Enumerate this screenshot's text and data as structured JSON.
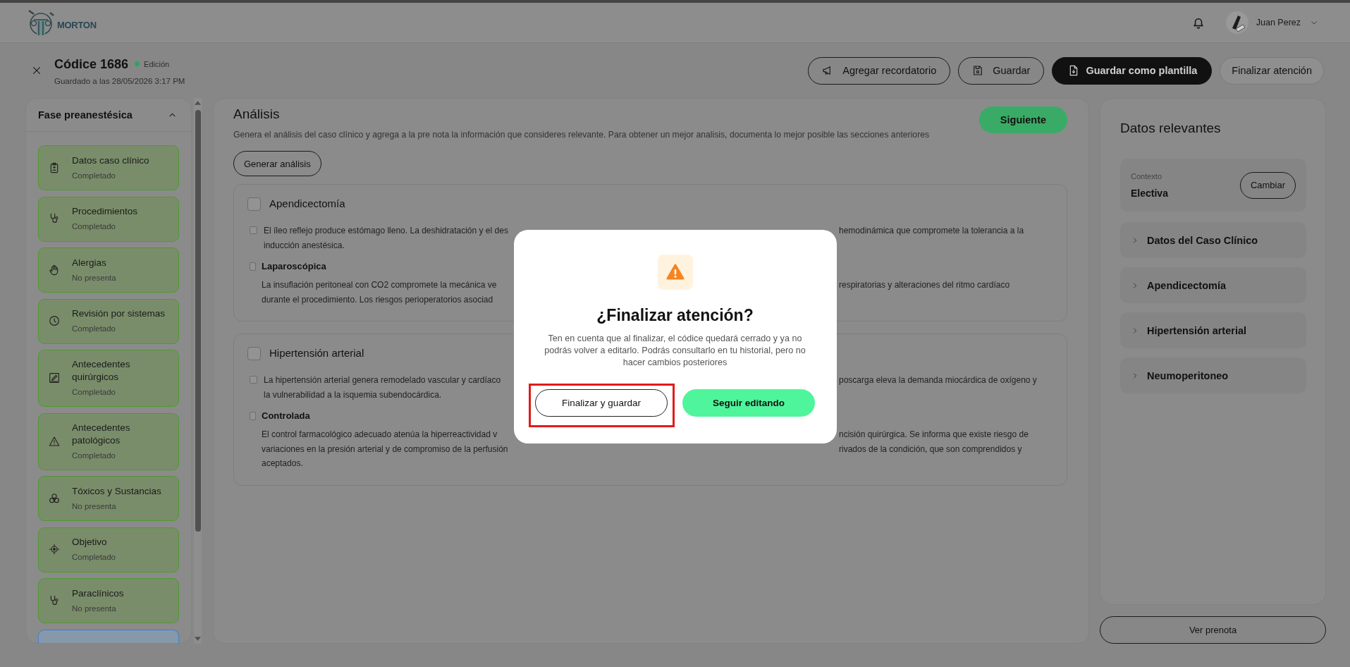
{
  "header": {
    "logo_text": "MORTON",
    "user_name": "Juan Perez"
  },
  "record": {
    "title": "Códice 1686",
    "status": "Edición",
    "saved_at": "Guardado a las 28/05/2026 3:17 PM"
  },
  "actions": [
    {
      "label": "Agregar recordatorio",
      "kind": "reminder"
    },
    {
      "label": "Guardar",
      "kind": "save"
    },
    {
      "label": "Guardar como plantilla",
      "kind": "template"
    },
    {
      "label": "Finalizar atención",
      "kind": "finish"
    }
  ],
  "sidebar": {
    "title": "Fase preanestésica",
    "expanded": true,
    "items": [
      {
        "label": "Datos caso clínico",
        "status": "Completado",
        "selected": false
      },
      {
        "label": "Procedimientos",
        "status": "Completado",
        "selected": false
      },
      {
        "label": "Alergias",
        "status": "No presenta",
        "selected": false
      },
      {
        "label": "Revisión por sistemas",
        "status": "Completado",
        "selected": false
      },
      {
        "label": "Antecedentes quirúrgicos",
        "status": "Completado",
        "selected": false
      },
      {
        "label": "Antecedentes patológicos",
        "status": "Completado",
        "selected": false
      },
      {
        "label": "Tóxicos y Sustancias",
        "status": "No presenta",
        "selected": false
      },
      {
        "label": "Objetivo",
        "status": "Completado",
        "selected": false
      },
      {
        "label": "Paraclínicos",
        "status": "No presenta",
        "selected": false
      },
      {
        "selected": true
      }
    ]
  },
  "analysis": {
    "title": "Análisis",
    "description": "Genera el análisis del caso clínico y agrega a la pre nota la información que consideres relevante. Para obtener un mejor analisis, documenta lo mejor posible las secciones anteriores",
    "next_button": "Siguiente",
    "generate_button": "Generar análisis",
    "cards": [
      {
        "title": "Apendicectomía",
        "checked": false,
        "entries": [
          {
            "kind": "text",
            "checked": false,
            "lines": [
              {
                "left": "El íleo reflejo produce estómago lleno. La deshidratación y el des",
                "right": "hemodinámica que compromete la tolerancia a la"
              },
              {
                "left": "inducción anestésica."
              }
            ]
          },
          {
            "kind": "option",
            "checked": false,
            "label": "Laparoscópica",
            "lines": [
              {
                "left": "La insuflación peritoneal con CO2 compromete la mecánica ve",
                "right": "respiratorias y alteraciones del ritmo cardíaco"
              },
              {
                "left": "durante el procedimiento. Los riesgos perioperatorios asociad"
              }
            ]
          }
        ]
      },
      {
        "title": "Hipertensión arterial",
        "checked": false,
        "entries": [
          {
            "kind": "text",
            "checked": false,
            "lines": [
              {
                "left": "La hipertensión arterial genera remodelado vascular y cardíaco",
                "right": "poscarga eleva la demanda miocárdica de oxígeno y"
              },
              {
                "left": "la vulnerabilidad a la isquemia subendocárdica."
              }
            ]
          },
          {
            "kind": "option",
            "checked": false,
            "label": "Controlada",
            "lines": [
              {
                "left": "El control farmacológico adecuado atenúa la hiperreactividad v",
                "right": "ncisión quirúrgica. Se informa que existe riesgo de"
              },
              {
                "left": "variaciones en la presión arterial y de compromiso de la perfusión",
                "right": "rivados de la condición, que son comprendidos y"
              },
              {
                "left": "aceptados."
              }
            ]
          }
        ]
      }
    ]
  },
  "relevant": {
    "title": "Datos relevantes",
    "context_label": "Contexto",
    "context_value": "Electiva",
    "change_button": "Cambiar",
    "sections": [
      {
        "label": "Datos del Caso Clínico",
        "expanded": false
      },
      {
        "label": "Apendicectomía",
        "expanded": false
      },
      {
        "label": "Hipertensión arterial",
        "expanded": false
      },
      {
        "label": "Neumoperitoneo",
        "expanded": false
      }
    ],
    "prenote_button": "Ver prenota"
  },
  "dialog": {
    "title": "¿Finalizar atención?",
    "message": "Ten en cuenta que al finalizar, el códice quedará cerrado y ya no podrás volver a editarlo. Podrás consultarlo en tu historial, pero no hacer cambios posteriores",
    "buttons": [
      {
        "label": "Finalizar y guardar",
        "kind": "secondary",
        "highlighted": true
      },
      {
        "label": "Seguir editando",
        "kind": "primary",
        "highlighted": false
      }
    ]
  }
}
